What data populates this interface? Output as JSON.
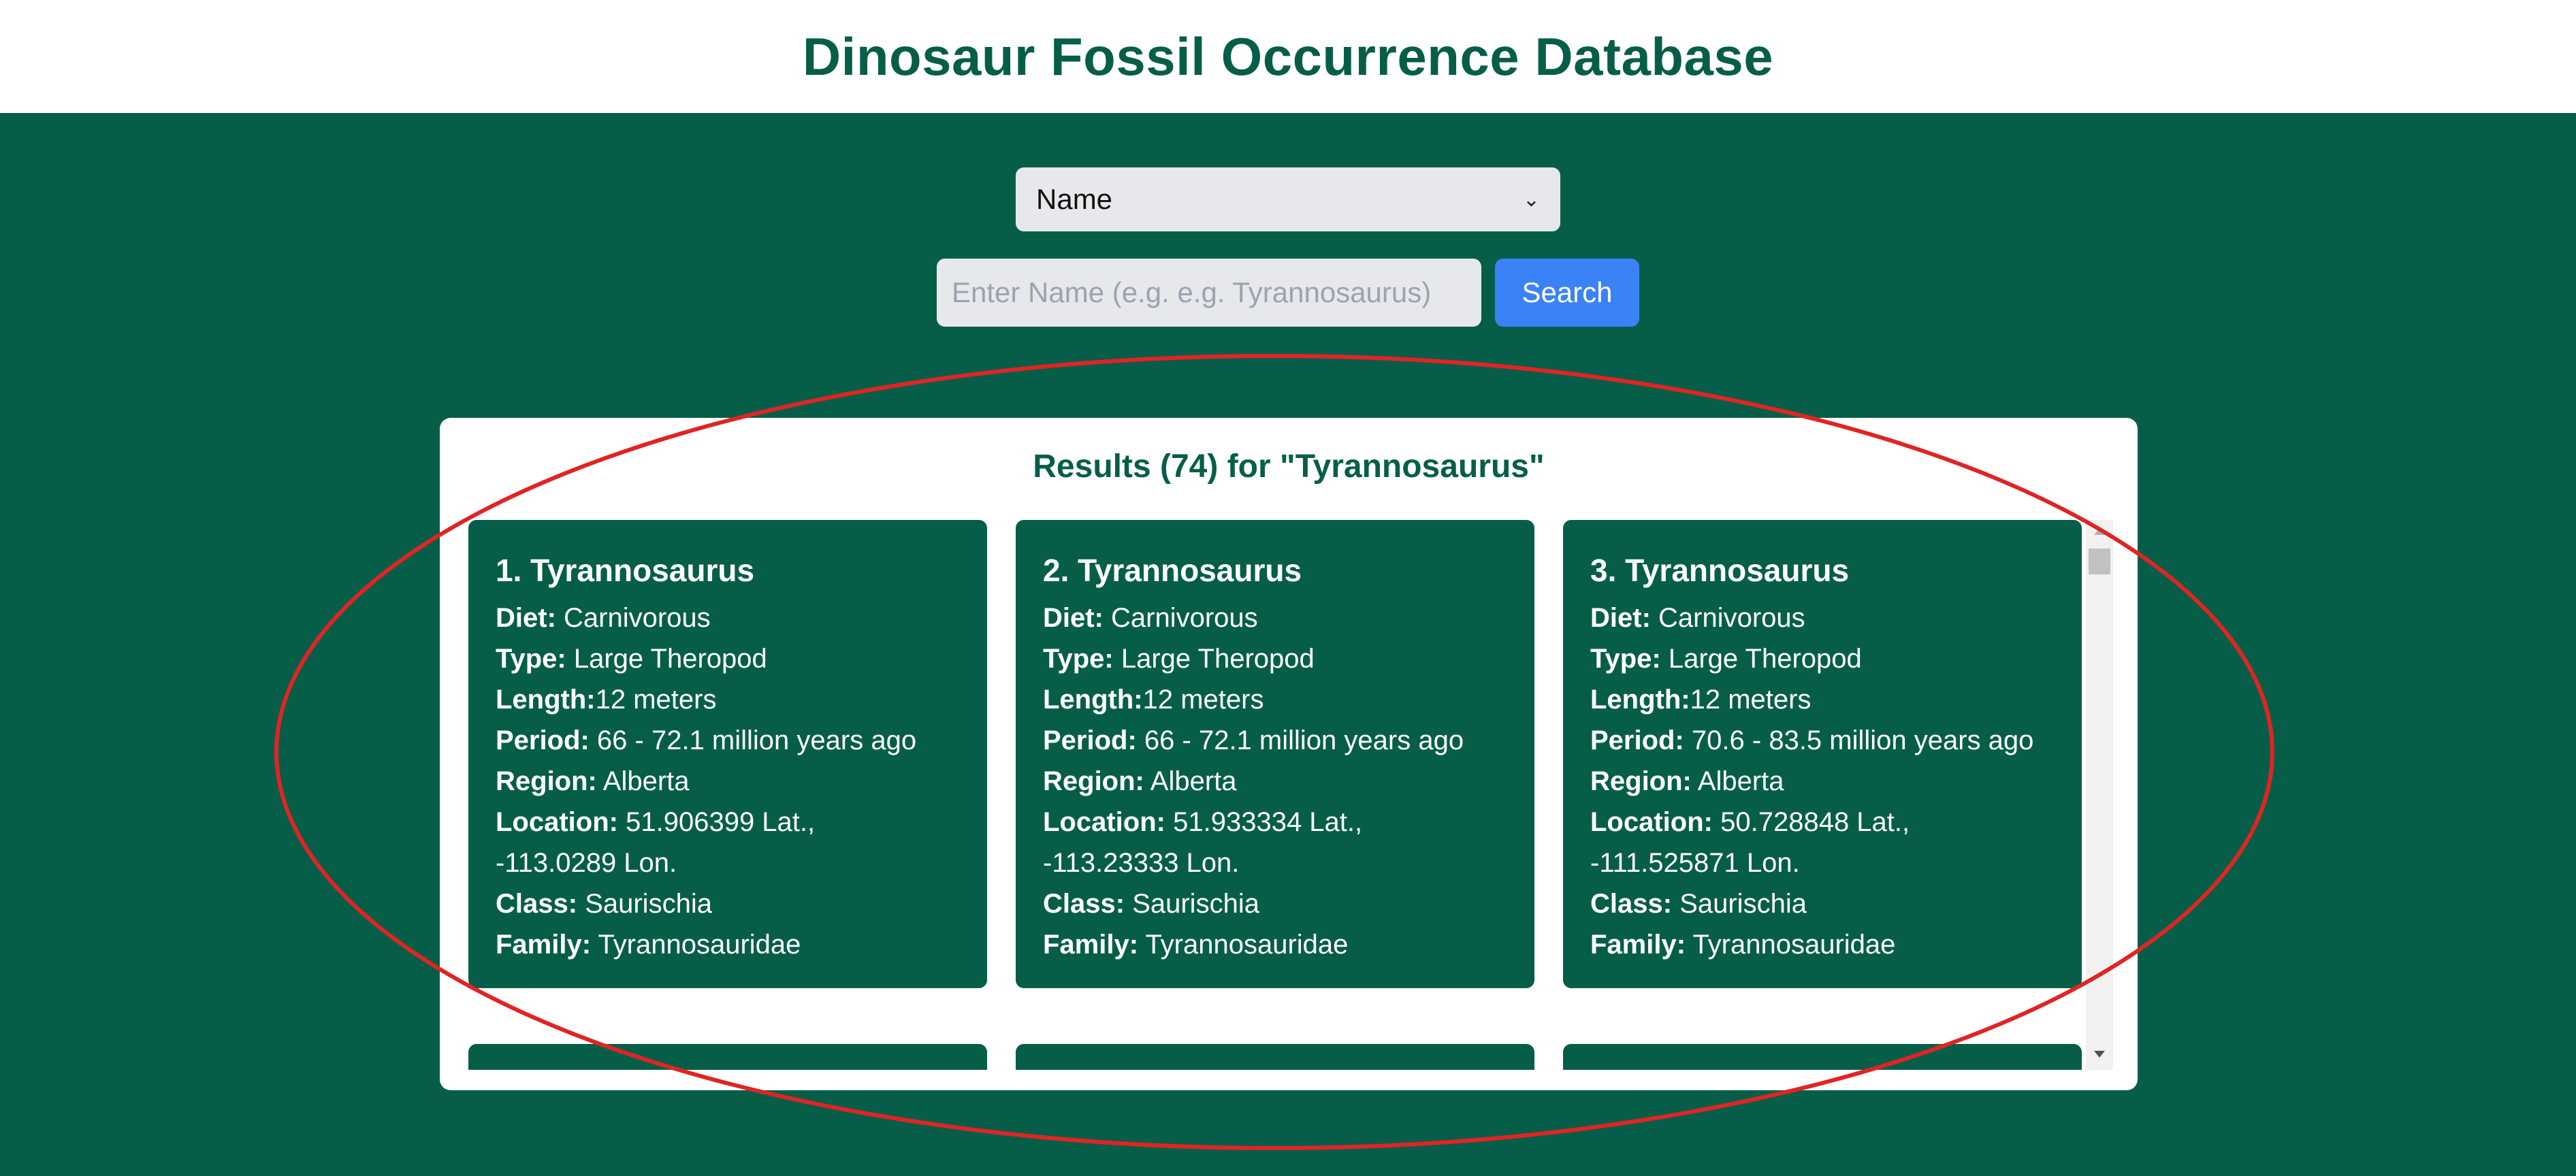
{
  "header": {
    "title": "Dinosaur Fossil Occurrence Database"
  },
  "search": {
    "field_selected": "Name",
    "placeholder": "Enter Name (e.g. e.g. Tyrannosaurus)",
    "button_label": "Search"
  },
  "results": {
    "title": "Results (74) for \"Tyrannosaurus\"",
    "labels": {
      "diet": "Diet:",
      "type": "Type:",
      "length": "Length:",
      "period": "Period:",
      "region": "Region:",
      "location": "Location:",
      "class": "Class:",
      "family": "Family:"
    },
    "items": [
      {
        "title": "1. Tyrannosaurus",
        "diet": "Carnivorous",
        "type": "Large Theropod",
        "length": "12 meters",
        "period": "66 - 72.1 million years ago",
        "region": "Alberta",
        "location_line1": "51.906399 Lat.,",
        "location_line2": "-113.0289 Lon.",
        "class": "Saurischia",
        "family": "Tyrannosauridae"
      },
      {
        "title": "2. Tyrannosaurus",
        "diet": "Carnivorous",
        "type": "Large Theropod",
        "length": "12 meters",
        "period": "66 - 72.1 million years ago",
        "region": "Alberta",
        "location_line1": "51.933334 Lat.,",
        "location_line2": "-113.23333 Lon.",
        "class": "Saurischia",
        "family": "Tyrannosauridae"
      },
      {
        "title": "3. Tyrannosaurus",
        "diet": "Carnivorous",
        "type": "Large Theropod",
        "length": "12 meters",
        "period": "70.6 - 83.5 million years ago",
        "region": "Alberta",
        "location_line1": "50.728848 Lat.,",
        "location_line2": "-111.525871 Lon.",
        "class": "Saurischia",
        "family": "Tyrannosauridae"
      }
    ]
  },
  "colors": {
    "brand": "#075e48",
    "accent": "#3b82f6",
    "annotation": "#e02424"
  }
}
